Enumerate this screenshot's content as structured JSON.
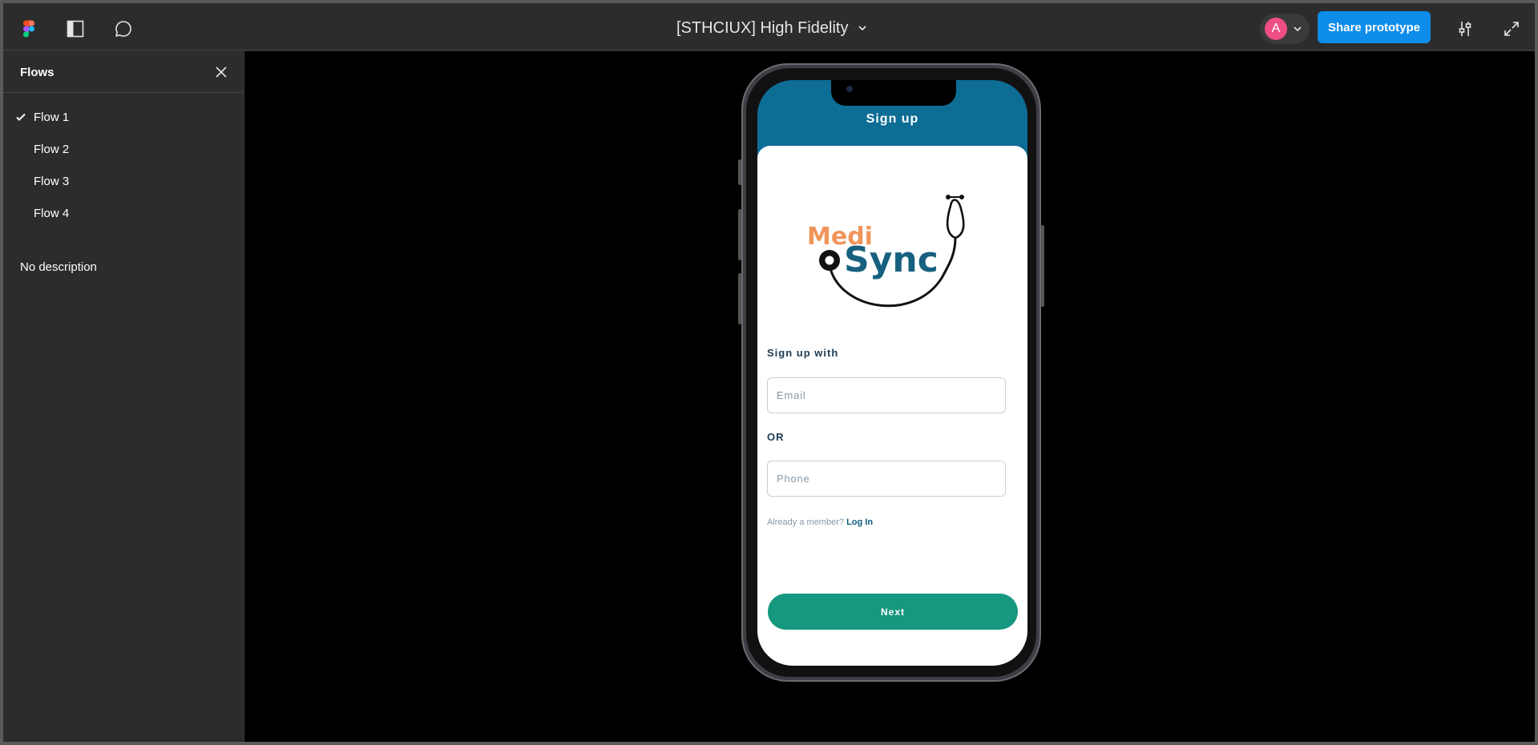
{
  "topbar": {
    "doc_title": "[STHCIUX] High Fidelity",
    "avatar_initial": "A",
    "share_label": "Share prototype",
    "icons": [
      "figma-logo-icon",
      "sidebar-toggle-icon",
      "comment-icon",
      "chevron-down-icon",
      "settings-sliders-icon",
      "expand-fullscreen-icon"
    ]
  },
  "sidebar": {
    "title": "Flows",
    "flows": [
      {
        "label": "Flow 1",
        "selected": true
      },
      {
        "label": "Flow 2",
        "selected": false
      },
      {
        "label": "Flow 3",
        "selected": false
      },
      {
        "label": "Flow 4",
        "selected": false
      }
    ],
    "description": "No description"
  },
  "phone": {
    "title": "Sign up",
    "logo_top": "Medi",
    "logo_bottom": "Sync",
    "signup_with": "Sign up with",
    "email_placeholder": "Email",
    "or_label": "OR",
    "phone_placeholder": "Phone",
    "member_text": "Already a member?",
    "login_label": "Log In",
    "next_label": "Next"
  },
  "colors": {
    "accent": "#0d8ce9",
    "avatar": "#ee4e84",
    "header": "#0d6d95",
    "next_button": "#16977f",
    "logo_orange": "#f0955a",
    "logo_teal": "#17607f"
  }
}
